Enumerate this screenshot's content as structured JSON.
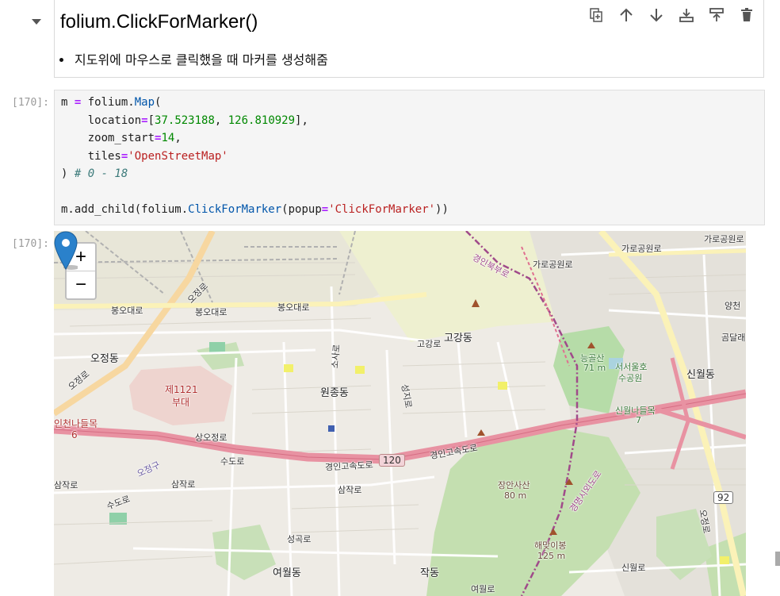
{
  "markdown_cell": {
    "title": "folium.ClickForMarker()",
    "bullets": [
      "지도위에 마우스로 클릭했을 때 마커를 생성해줌"
    ],
    "toolbar": [
      {
        "name": "duplicate",
        "icon": "duplicate-icon"
      },
      {
        "name": "move-up",
        "icon": "arrow-up-icon"
      },
      {
        "name": "move-down",
        "icon": "arrow-down-icon"
      },
      {
        "name": "insert-above",
        "icon": "insert-above-icon"
      },
      {
        "name": "insert-below",
        "icon": "insert-below-icon"
      },
      {
        "name": "delete",
        "icon": "trash-icon"
      }
    ]
  },
  "code_cell": {
    "prompt": "[170]:",
    "lines": [
      "m = folium.Map(",
      "    location=[37.523188, 126.810929],",
      "    zoom_start=14,",
      "    tiles='OpenStreetMap'",
      ") # 0 - 18",
      "",
      "m.add_child(folium.ClickForMarker(popup='ClickForMarker'))"
    ]
  },
  "output_cell": {
    "prompt": "[170]:",
    "zoom_in": "+",
    "zoom_out": "−",
    "map_labels": {
      "ojeongro": "오정로",
      "bongodaero_1": "봉오대로",
      "bongodaero_2": "봉오대로",
      "bongodaero_3": "봉오대로",
      "ojeongdong": "오정동",
      "ojeongro_2": "오정로",
      "unit_1121_a": "제1121",
      "unit_1121_b": "부대",
      "wonjongdong": "원종동",
      "gogangro": "고강로",
      "gogangdong": "고강동",
      "sosaro": "소사로",
      "seongjiro": "성지로",
      "gyeongin_1": "경인고속도로",
      "gyeongin_2": "경인고속도로",
      "shield_120": "120",
      "sangocheongno": "상오정로",
      "sudoro": "수도로",
      "ojeonggu": "오정구",
      "samjakro_1": "삼작로",
      "samjakro_2": "삼작로",
      "samjakro_3": "삼작로",
      "sudoro_2": "수도로",
      "incheon_ic": "인천나들목",
      "incheon_ic_num": "6",
      "jangansasan": "장안사산",
      "jangansasan_h": "80 m",
      "haemaji": "해맞이봉",
      "haemaji_h": "125 m",
      "jakdong": "작동",
      "yeowoldong": "여월동",
      "yeowolro": "여월로",
      "seongjugongro": "성곡로",
      "sinwoldong": "신월동",
      "sinwol_ic": "신월나들목",
      "sinwol_ic_num": "7",
      "neunggolsan": "능골산",
      "neunggolsan_h": "71 m",
      "seoseo_park_a": "서서울호",
      "seoseo_park_b": "수공원",
      "garo_1": "가로공원로",
      "garo_2": "가로공원로",
      "garo_3": "가로공원로",
      "gyeongin_bukbu": "경인북부로",
      "gyeongmyeong_1": "경명시외도로",
      "shield_92": "92",
      "gondalae": "곰달래",
      "yangcheon": "양천",
      "sinwolro": "신월로",
      "ohseoro": "오정로"
    }
  }
}
